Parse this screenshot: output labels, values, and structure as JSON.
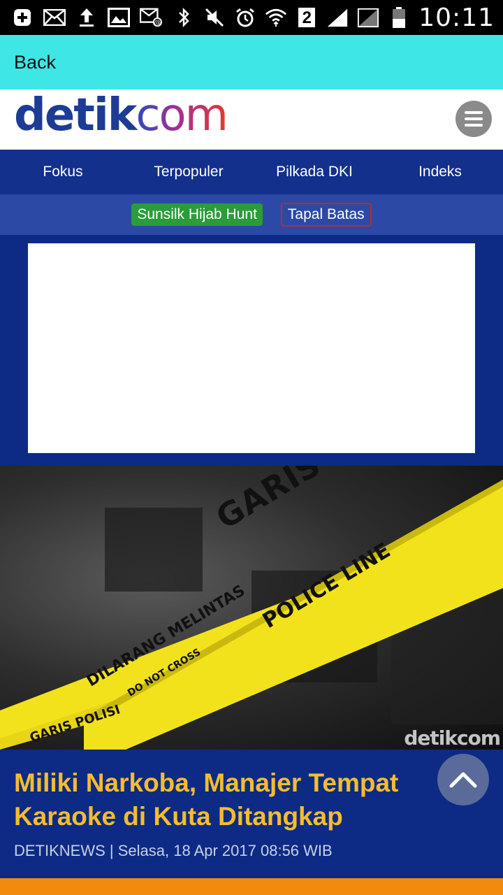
{
  "status_bar": {
    "time": "10:11",
    "sim_badge": "2",
    "icons": [
      "add-icon",
      "mail-icon",
      "upload-icon",
      "image-icon",
      "email-at-icon",
      "bluetooth-icon",
      "mute-icon",
      "alarm-icon",
      "wifi-icon",
      "signal-icon",
      "battery-icon"
    ]
  },
  "app_bar": {
    "back_label": "Back"
  },
  "header": {
    "logo_part1": "detik",
    "logo_part2": "com",
    "menu_icon": "hamburger-icon"
  },
  "nav": {
    "items": [
      "Fokus",
      "Terpopuler",
      "Pilkada DKI",
      "Indeks"
    ]
  },
  "subnav": {
    "tag_green": "Sunsilk Hijab Hunt",
    "tag_red": "Tapal Batas"
  },
  "photo": {
    "tape_main": "GARIS POLISI",
    "tape_sub": "POLICE LINE",
    "tape_lower": "DILARANG MELINTAS",
    "tape_lower_sub": "DO NOT CROSS",
    "tape_bottom": "GARIS POLISI",
    "watermark": "detikcom"
  },
  "article": {
    "headline": "Miliki Narkoba, Manajer Tempat Karaoke di Kuta Ditangkap",
    "meta": "DETIKNEWS | Selasa, 18 Apr 2017 08:56 WIB"
  },
  "colors": {
    "nav_blue": "#12308c",
    "headline_yellow": "#f5bd2c",
    "app_bar": "#3ee6e6",
    "tape_yellow": "#f2e21b"
  }
}
